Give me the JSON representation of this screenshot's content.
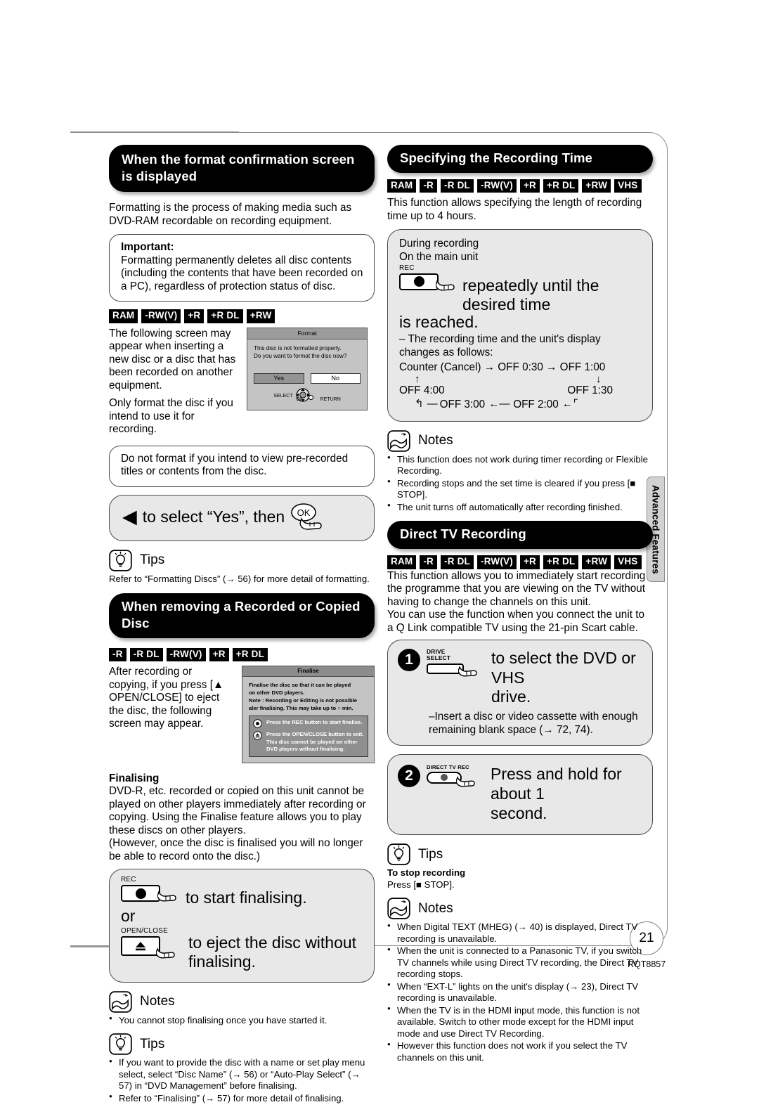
{
  "page": {
    "number": "21",
    "doc_code": "RQT8857",
    "side_tab": "Advanced Features"
  },
  "left": {
    "section1": {
      "heading": "When the format confirmation screen is displayed",
      "intro": "Formatting is the process of making media such as DVD-RAM recordable on recording equipment.",
      "important_label": "Important:",
      "important_text": "Formatting permanently deletes all disc contents (including the contents that have been recorded on a PC), regardless of protection status of disc.",
      "badges": [
        "RAM",
        "-RW(V)",
        "+R",
        "+R DL",
        "+RW"
      ],
      "para1": "The following screen may appear when inserting a new disc or a disc that has been recorded on another equipment.",
      "para2": "Only format the disc if you intend to use it for recording.",
      "caution": "Do not format if you intend to view pre-recorded titles or contents from the disc.",
      "action_text": "to select “Yes”, then",
      "action_left_arrow": "◀",
      "ok_button_label": "OK",
      "tips_label": "Tips",
      "tips_text": "Refer to “Formatting Discs” (→ 56) for more detail of formatting."
    },
    "format_osd": {
      "title": "Format",
      "line1": "This disc is not formatted properly.",
      "line2": "Do you want to format the disc now?",
      "yes": "Yes",
      "no": "No",
      "select_label": "SELECT",
      "ok_label": "OK",
      "return_label": "RETURN"
    },
    "section2": {
      "heading": "When removing a Recorded or Copied Disc",
      "badges": [
        "-R",
        "-R DL",
        "-RW(V)",
        "+R",
        "+R DL"
      ],
      "para": "After recording or copying, if you press [▲ OPEN/CLOSE] to eject the disc, the following screen may appear.",
      "finalising_label": "Finalising",
      "finalising_text": "DVD-R, etc. recorded or copied on this unit cannot be played on other players immediately after recording or copying. Using the Finalise feature allows you to play these discs on other players.",
      "finalising_text2": "(However, once the disc is finalised you will no longer be able to record onto the disc.)",
      "rec_caption": "REC",
      "rec_action": "to start finalising.",
      "or_label": "or",
      "eject_caption": "OPEN/CLOSE",
      "eject_action": "to eject the disc without finalising.",
      "notes_label": "Notes",
      "notes": [
        "You cannot stop finalising once you have started it."
      ],
      "tips_label": "Tips",
      "tips": [
        "If you want to provide the disc with a name or set play menu select, select “Disc Name” (→ 56) or “Auto-Play Select” (→ 57) in “DVD Management” before finalising.",
        "Refer to “Finalising” (→ 57) for more detail of finalising."
      ]
    },
    "finalise_osd": {
      "title": "Finalise",
      "line1": "Finalise the disc so that it can be played",
      "line2": "on other DVD players.",
      "line3": "Note : Recording or Editing is not possible",
      "line4": "aler finalising. This may take up to ○ min.",
      "opt1": "Press the REC button to start finalise.",
      "opt2_line1": "Press the OPEN/CLOSE button to exit.",
      "opt2_line2": "This disc cannot be played on other",
      "opt2_line3": "DVD players without finalising."
    }
  },
  "right": {
    "section1": {
      "heading": "Specifying the Recording Time",
      "badges": [
        "RAM",
        "-R",
        "-R DL",
        "-RW(V)",
        "+R",
        "+R DL",
        "+RW",
        "VHS"
      ],
      "intro": "This function allows specifying the length of recording time up to 4 hours.",
      "during_recording": "During recording",
      "on_main_unit": "On the main unit",
      "rec_caption": "REC",
      "action_line1": "repeatedly until the desired time",
      "action_line2": "is reached.",
      "dash_note": "– The recording time and the unit's display changes as follows:",
      "flow": {
        "row1": "Counter (Cancel) → OFF 0:30 → OFF 1:00",
        "left_item": "OFF 4:00",
        "right_item": "OFF 1:30",
        "row3_a": "OFF 3:00",
        "row3_b": "OFF 2:00"
      },
      "notes_label": "Notes",
      "notes": [
        "This function does not work during timer recording or Flexible Recording.",
        "Recording stops and the set time is cleared if you press [■ STOP].",
        "The unit turns off automatically after recording finished."
      ]
    },
    "section2": {
      "heading": "Direct TV Recording",
      "badges": [
        "RAM",
        "-R",
        "-R DL",
        "-RW(V)",
        "+R",
        "+R DL",
        "+RW",
        "VHS"
      ],
      "intro1": "This function allows you to immediately start recording the programme that you are viewing on the TV without having to change the channels on this unit.",
      "intro2": "You can use the function when you connect the unit to a Q Link compatible TV using the 21-pin Scart cable.",
      "step1_num": "❶",
      "step1_caption_line1": "DRIVE",
      "step1_caption_line2": "SELECT",
      "step1_action_line1": "to select the DVD or VHS",
      "step1_action_line2": "drive.",
      "step1_note": "–Insert a disc or video cassette with enough remaining blank space (→ 72, 74).",
      "step2_num": "❷",
      "step2_caption": "DIRECT TV REC",
      "step2_action_line1": "Press and hold for about 1",
      "step2_action_line2": "second.",
      "tips_label": "Tips",
      "tips_head": "To stop recording",
      "tips_text": "Press [■ STOP].",
      "notes_label": "Notes",
      "notes": [
        "When Digital TEXT (MHEG) (→ 40) is displayed, Direct TV recording is unavailable.",
        "When the unit is connected to a Panasonic TV, if you switch TV channels while using Direct TV recording, the Direct TV recording stops.",
        "When “EXT-L” lights on the unit's display (→ 23), Direct TV recording is unavailable.",
        "When the TV is in the HDMI input mode, this function is not available. Switch to other mode except for the HDMI input mode and use Direct TV Recording.",
        "However this function does not work if you select the TV channels on this unit."
      ]
    }
  }
}
